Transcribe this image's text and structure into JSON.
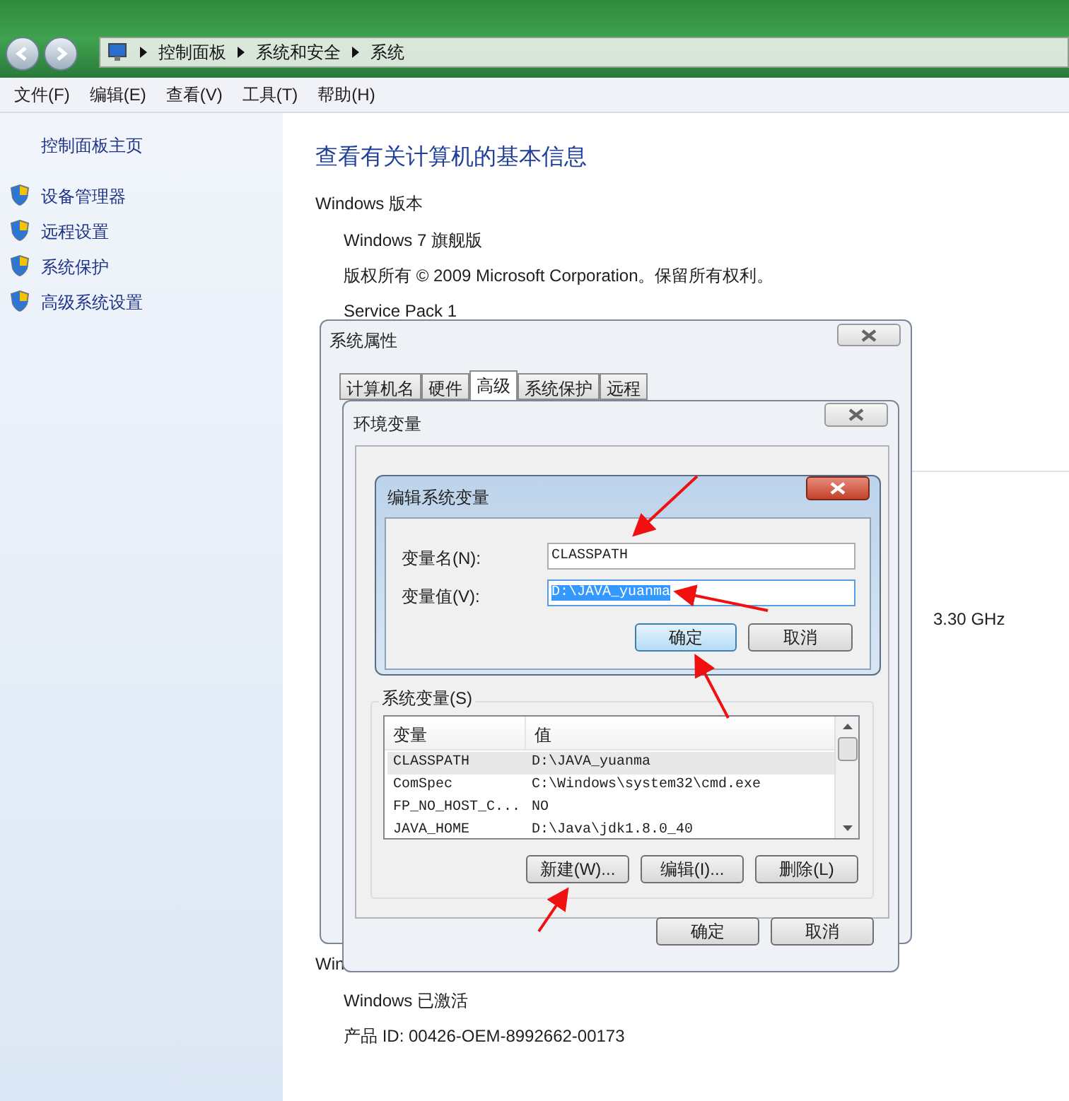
{
  "address_bar": {
    "path": [
      "控制面板",
      "系统和安全",
      "系统"
    ]
  },
  "menu": [
    "文件(F)",
    "编辑(E)",
    "查看(V)",
    "工具(T)",
    "帮助(H)"
  ],
  "sidebar": {
    "home": "控制面板主页",
    "items": [
      "设备管理器",
      "远程设置",
      "系统保护",
      "高级系统设置"
    ]
  },
  "main": {
    "heading": "查看有关计算机的基本信息",
    "section": "Windows 版本",
    "lines": [
      "Windows 7 旗舰版",
      "版权所有 © 2009 Microsoft Corporation。保留所有权利。",
      "Service Pack 1"
    ],
    "speed": "3.30 GHz",
    "section_2": "Win",
    "activation": "Windows 已激活",
    "product_id": "产品 ID: 00426-OEM-8992662-00173"
  },
  "system_properties": {
    "title": "系统属性",
    "tabs": [
      {
        "label": "计算机名",
        "selected": false
      },
      {
        "label": "硬件",
        "selected": false
      },
      {
        "label": "高级",
        "selected": true
      },
      {
        "label": "系统保护",
        "selected": false
      },
      {
        "label": "远程",
        "selected": false
      }
    ]
  },
  "env_dialog": {
    "title": "环境变量",
    "group": "系统变量(S)",
    "columns": [
      "变量",
      "值"
    ],
    "rows": [
      {
        "name": "CLASSPATH",
        "value": "D:\\JAVA_yuanma",
        "selected": true
      },
      {
        "name": "ComSpec",
        "value": "C:\\Windows\\system32\\cmd.exe",
        "selected": false
      },
      {
        "name": "FP_NO_HOST_C...",
        "value": "NO",
        "selected": false
      },
      {
        "name": "JAVA_HOME",
        "value": "D:\\Java\\jdk1.8.0_40",
        "selected": false
      }
    ],
    "list_buttons": [
      "新建(W)...",
      "编辑(I)...",
      "删除(L)"
    ],
    "ok": "确定",
    "cancel": "取消"
  },
  "edit_dialog": {
    "title": "编辑系统变量",
    "name_label": "变量名(N):",
    "name_value": "CLASSPATH",
    "value_label": "变量值(V):",
    "value_value": "D:\\JAVA_yuanma",
    "ok": "确定",
    "cancel": "取消"
  }
}
